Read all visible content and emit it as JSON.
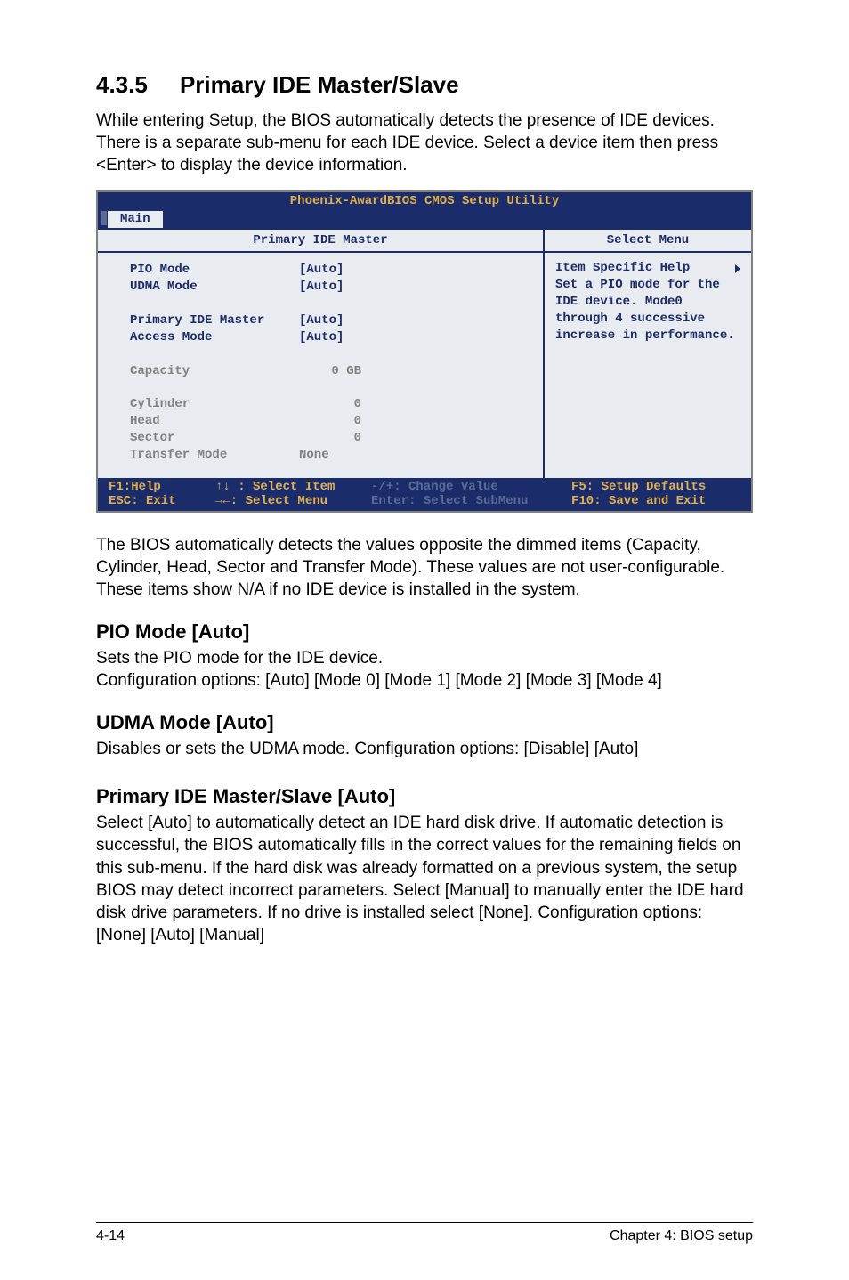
{
  "section": {
    "num": "4.3.5",
    "title": "Primary IDE Master/Slave"
  },
  "intro": "While entering Setup, the BIOS automatically detects the presence of IDE devices. There is a separate sub-menu for each IDE device. Select a device item then press <Enter> to display the device information.",
  "bios": {
    "title": "Phoenix-AwardBIOS CMOS Setup Utility",
    "tab": "Main",
    "left_header": "Primary IDE Master",
    "right_header": "Select Menu",
    "items": [
      {
        "label": "PIO Mode",
        "value": "[Auto]",
        "cls": "u"
      },
      {
        "label": "UDMA Mode",
        "value": "[Auto]",
        "cls": "u"
      },
      {
        "label": "",
        "value": ""
      },
      {
        "label": "Primary IDE Master",
        "value": "[Auto]",
        "cls": "u"
      },
      {
        "label": "Access Mode",
        "value": "[Auto]",
        "cls": "u"
      },
      {
        "label": "",
        "value": ""
      },
      {
        "label": "Capacity",
        "value": "0 GB",
        "cls": "d",
        "numcol": true
      },
      {
        "label": "",
        "value": ""
      },
      {
        "label": "Cylinder",
        "value": "0",
        "cls": "d",
        "numcol": true
      },
      {
        "label": "Head",
        "value": "0",
        "cls": "d",
        "numcol": true
      },
      {
        "label": "Sector",
        "value": "0",
        "cls": "d",
        "numcol": true
      },
      {
        "label": "Transfer Mode",
        "value": "None",
        "cls": "d"
      }
    ],
    "help": {
      "heading": "Item Specific Help",
      "text": "Set a PIO mode for the IDE device. Mode0 through 4 successive increase in performance."
    },
    "footer": {
      "c1a": "F1:Help",
      "c1b": "ESC: Exit",
      "c2a": "↑↓ : Select Item",
      "c2b": "→←: Select Menu",
      "c3a": "-/+: Change Value",
      "c3b": "Enter: Select SubMenu",
      "c4a": "F5: Setup Defaults",
      "c4b": "F10: Save and Exit"
    }
  },
  "after_bios": "The BIOS automatically detects the values opposite the dimmed items (Capacity, Cylinder, Head, Sector and Transfer Mode). These values are not user-configurable. These items show N/A if no IDE device is installed in the system.",
  "sub1": {
    "h": "PIO Mode [Auto]",
    "l1": "Sets the PIO mode for the IDE device.",
    "l2": "Configuration options: [Auto] [Mode 0] [Mode 1] [Mode 2] [Mode 3] [Mode 4]"
  },
  "sub2": {
    "h": "UDMA Mode [Auto]",
    "l1": "Disables or sets the UDMA mode. Configuration options: [Disable] [Auto]"
  },
  "sub3": {
    "h": "Primary IDE Master/Slave [Auto]",
    "l1": "Select [Auto] to automatically detect an IDE hard disk drive. If automatic detection is successful, the BIOS automatically fills in the correct values for the remaining fields on this sub-menu. If the hard disk was already formatted on a previous system, the setup BIOS may detect incorrect parameters. Select [Manual] to manually enter the IDE hard disk drive parameters. If no drive is installed select [None]. Configuration options: [None] [Auto] [Manual]"
  },
  "footer": {
    "left": "4-14",
    "right": "Chapter 4: BIOS setup"
  }
}
